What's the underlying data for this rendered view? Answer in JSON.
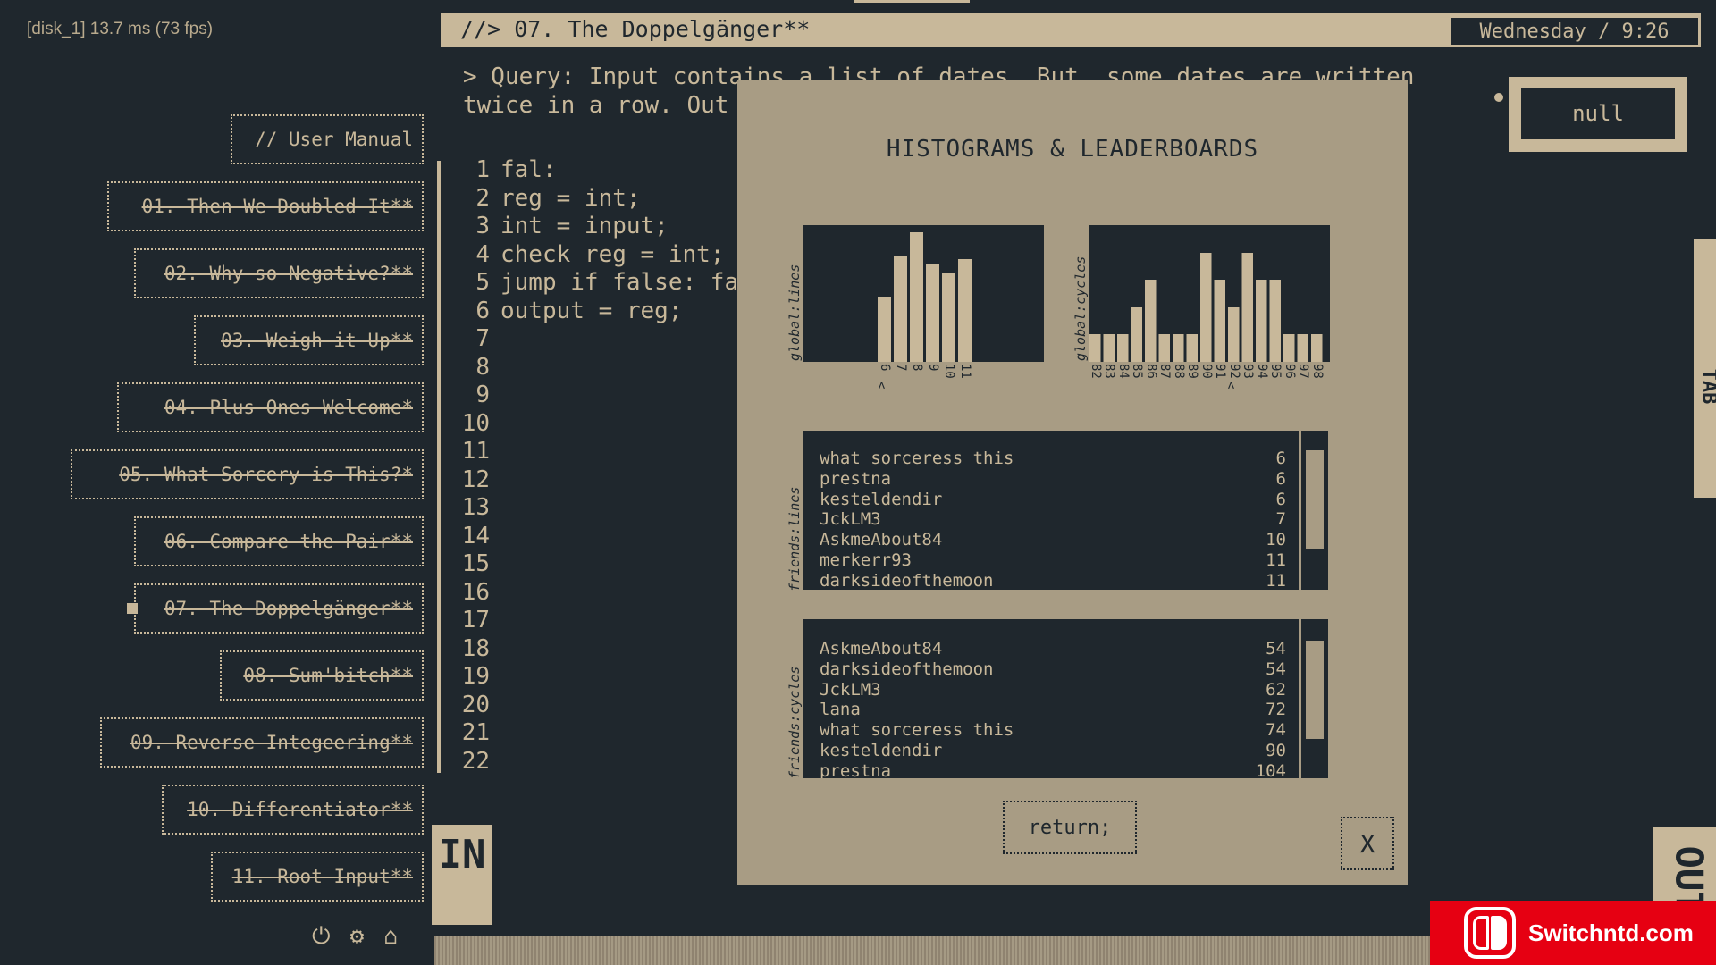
{
  "perf": "[disk_1] 13.7 ms (73 fps)",
  "menu": {
    "manual": "// User Manual",
    "levels": [
      "01. Then We Doubled It**",
      "02. Why so Negative?**",
      "03. Weigh it Up**",
      "04. Plus Ones Welcome*",
      "05. What Sorcery is This?*",
      "06. Compare the Pair**",
      "07. The Doppelgänger**",
      "08. Sum'bitch**",
      "09. Reverse Integeering**",
      "10. Differentiator**",
      "11. Root Input**"
    ],
    "current_index": 6,
    "icons": [
      "power-icon",
      "gear-icon",
      "home-icon"
    ]
  },
  "header": {
    "title": "//> 07. The Doppelgänger**",
    "datetime": "Wednesday / 9:26"
  },
  "query": "> Query: Input contains a list of dates. But, some dates are written\ntwice in a row. Out",
  "code": {
    "lines": [
      "fal:",
      "reg = int;",
      "int = input;",
      "check reg = int;",
      "jump if false: fa",
      "output = reg;",
      "",
      "",
      "",
      "",
      "",
      "",
      "",
      "",
      "",
      "",
      "",
      "",
      "",
      "",
      "",
      ""
    ]
  },
  "null_box": "null",
  "side_tab": "TAB",
  "io": {
    "in": "IN",
    "out": "OUT"
  },
  "modal": {
    "title": "HISTOGRAMS & LEADERBOARDS",
    "hist_lines_label": "global:lines",
    "hist_cycles_label": "global:cycles",
    "friends_lines_label": "friends:lines",
    "friends_cycles_label": "friends:cycles",
    "friends_lines": [
      {
        "name": "what sorceress this",
        "score": "6"
      },
      {
        "name": "prestna",
        "score": "6"
      },
      {
        "name": "kesteldendir",
        "score": "6"
      },
      {
        "name": "JckLM3",
        "score": "7"
      },
      {
        "name": "AskmeAbout84",
        "score": "10"
      },
      {
        "name": "merkerr93",
        "score": "11"
      },
      {
        "name": "darksideofthemoon",
        "score": "11"
      }
    ],
    "friends_cycles": [
      {
        "name": "AskmeAbout84",
        "score": "54"
      },
      {
        "name": "darksideofthemoon",
        "score": "54"
      },
      {
        "name": "JckLM3",
        "score": "62"
      },
      {
        "name": "lana",
        "score": "72"
      },
      {
        "name": "what sorceress this",
        "score": "74"
      },
      {
        "name": "kesteldendir",
        "score": "90"
      },
      {
        "name": "prestna",
        "score": "104"
      }
    ],
    "return_label": "return;",
    "close_label": "X"
  },
  "chart_data": [
    {
      "type": "bar",
      "ylabel": "global:lines",
      "categories": [
        "6",
        "7",
        "8",
        "9",
        "10",
        "11"
      ],
      "values": [
        48,
        78,
        95,
        72,
        65,
        75
      ],
      "marker": "6"
    },
    {
      "type": "bar",
      "ylabel": "global:cycles",
      "categories": [
        "82",
        "83",
        "84",
        "85",
        "86",
        "87",
        "88",
        "89",
        "90",
        "91",
        "92",
        "93",
        "94",
        "95",
        "96",
        "97",
        "98"
      ],
      "values": [
        20,
        20,
        20,
        40,
        60,
        20,
        20,
        20,
        80,
        60,
        40,
        80,
        60,
        60,
        20,
        20,
        20
      ],
      "marker": "92"
    }
  ],
  "watermark": "Switchntd.com",
  "colors": {
    "background": "#1f272d",
    "foreground": "#c8b89a",
    "modal": "#a89c84",
    "watermark": "#e60012"
  }
}
